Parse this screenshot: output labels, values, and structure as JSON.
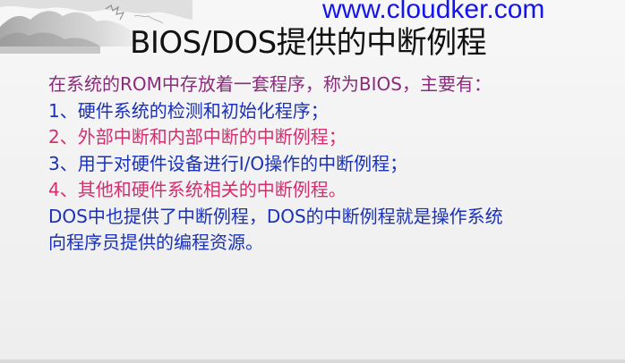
{
  "watermark": "www.cloudker.com",
  "title": "BIOS/DOS提供的中断例程",
  "lines": [
    "在系统的ROM中存放着一套程序，称为BIOS，主要有：",
    "1、硬件系统的检测和初始化程序；",
    "2、外部中断和内部中断的中断例程；",
    "3、用于对硬件设备进行I/O操作的中断例程；",
    "4、其他和硬件系统相关的中断例程。",
    "DOS中也提供了中断例程，DOS的中断例程就是操作系统",
    "向程序员提供的编程资源。"
  ],
  "colors": {
    "intro": "#8a2c7c",
    "item_blue": "#1a31b8",
    "item_pink": "#d42e6f",
    "watermark": "#1414ee"
  },
  "decoration": "ink-landscape-corner"
}
